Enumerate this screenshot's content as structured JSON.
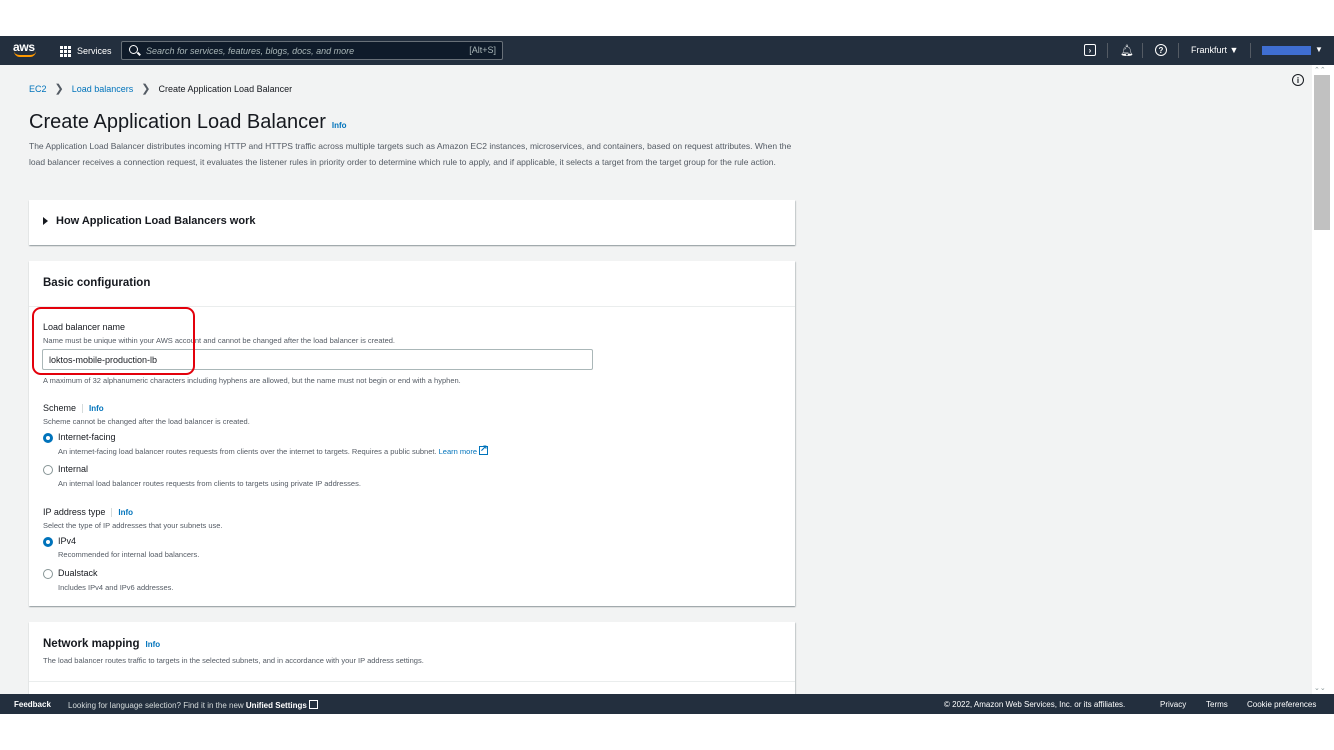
{
  "nav": {
    "logo": "aws",
    "services_label": "Services",
    "search_placeholder": "Search for services, features, blogs, docs, and more",
    "search_shortcut": "[Alt+S]",
    "region": "Frankfurt ▼",
    "account_caret": "▼",
    "icons": [
      "cloudshell-icon",
      "bell-icon",
      "help-icon"
    ]
  },
  "breadcrumb": {
    "items": [
      "EC2",
      "Load balancers"
    ],
    "current": "Create Application Load Balancer"
  },
  "page": {
    "title": "Create Application Load Balancer",
    "info": "Info",
    "description": "The Application Load Balancer distributes incoming HTTP and HTTPS traffic across multiple targets such as Amazon EC2 instances, microservices, and containers, based on request attributes. When the load balancer receives a connection request, it evaluates the listener rules in priority order to determine which rule to apply, and if applicable, it selects a target from the target group for the rule action."
  },
  "how_it_works": {
    "label": "How Application Load Balancers work"
  },
  "basic": {
    "title": "Basic configuration",
    "name_label": "Load balancer name",
    "name_desc": "Name must be unique within your AWS account and cannot be changed after the load balancer is created.",
    "name_value": "loktos-mobile-production-lb",
    "name_hint": "A maximum of 32 alphanumeric characters including hyphens are allowed, but the name must not begin or end with a hyphen.",
    "scheme_label": "Scheme",
    "scheme_info": "Info",
    "scheme_desc": "Scheme cannot be changed after the load balancer is created.",
    "scheme_options": [
      {
        "label": "Internet-facing",
        "desc": "An internet-facing load balancer routes requests from clients over the internet to targets. Requires a public subnet.",
        "link": "Learn more",
        "selected": true
      },
      {
        "label": "Internal",
        "desc": "An internal load balancer routes requests from clients to targets using private IP addresses.",
        "selected": false
      }
    ],
    "ip_label": "IP address type",
    "ip_info": "Info",
    "ip_desc": "Select the type of IP addresses that your subnets use.",
    "ip_options": [
      {
        "label": "IPv4",
        "desc": "Recommended for internal load balancers.",
        "selected": true
      },
      {
        "label": "Dualstack",
        "desc": "Includes IPv4 and IPv6 addresses.",
        "selected": false
      }
    ]
  },
  "network": {
    "title": "Network mapping",
    "info": "Info",
    "desc": "The load balancer routes traffic to targets in the selected subnets, and in accordance with your IP address settings."
  },
  "footer": {
    "feedback": "Feedback",
    "lang_text": "Looking for language selection? Find it in the new",
    "lang_link": "Unified Settings",
    "copyright": "© 2022, Amazon Web Services, Inc. or its affiliates.",
    "privacy": "Privacy",
    "terms": "Terms",
    "cookies": "Cookie preferences"
  },
  "colors": {
    "nav_bg": "#232f3e",
    "link": "#0073bb",
    "highlight": "#e3000b",
    "account_bar": "#3f6ed1"
  }
}
